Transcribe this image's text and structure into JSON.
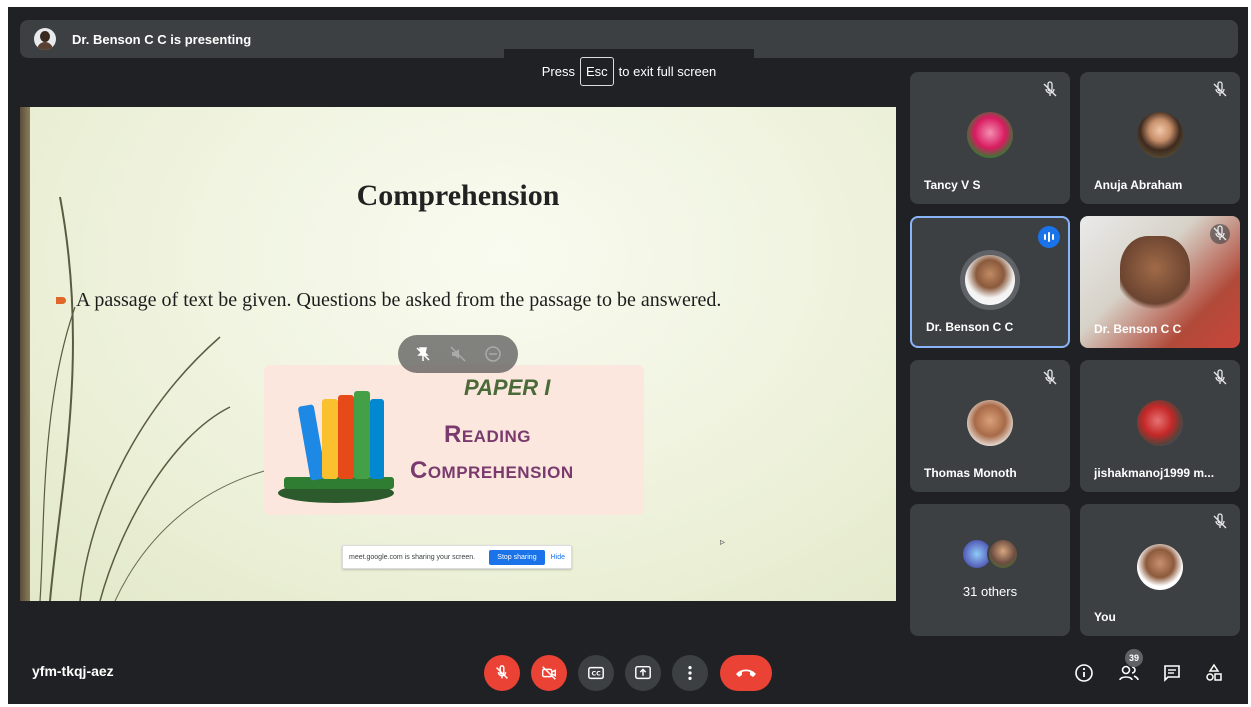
{
  "topbar": {
    "presenting_text": "Dr. Benson C C is presenting"
  },
  "fullscreen_toast": {
    "press": "Press",
    "key": "Esc",
    "rest": "to exit full screen"
  },
  "slide": {
    "title": "Comprehension",
    "bullet": "A passage of text be given. Questions be asked from the passage to be answered.",
    "card_line1": "PAPER I",
    "card_line2": "Reading",
    "card_line3": "Comprehension"
  },
  "share_bar": {
    "message": "meet.google.com is sharing your screen.",
    "stop_label": "Stop sharing",
    "hide_label": "Hide"
  },
  "participants": [
    {
      "name": "Tancy V S",
      "muted": true
    },
    {
      "name": "Anuja Abraham",
      "muted": true
    },
    {
      "name": "Dr. Benson C C",
      "muted": false,
      "speaking": true
    },
    {
      "name": "Dr. Benson C C",
      "muted": true
    },
    {
      "name": "Thomas Monoth",
      "muted": true
    },
    {
      "name": "jishakmanoj1999 m...",
      "muted": true
    },
    {
      "name": "31 others"
    },
    {
      "name": "You",
      "muted": true
    }
  ],
  "bottombar": {
    "meeting_code": "yfm-tkqj-aez",
    "people_count": "39",
    "controls": [
      "mic-off-icon",
      "camera-off-icon",
      "captions-icon",
      "present-icon",
      "more-options-icon",
      "end-call-icon"
    ],
    "right_icons": [
      "info-icon",
      "people-icon",
      "chat-icon",
      "activities-icon"
    ]
  },
  "colors": {
    "background": "#202124",
    "tile": "#3c4043",
    "danger": "#ea4335",
    "accent": "#1a73e8",
    "active_border": "#8ab4f8"
  }
}
